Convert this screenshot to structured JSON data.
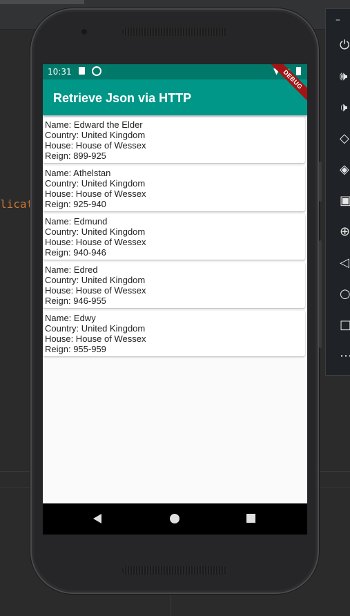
{
  "ide": {
    "code_fragment": "licat"
  },
  "emulator_controls": [
    {
      "icon": "power-icon",
      "glyph": "⏻"
    },
    {
      "icon": "volume-up-icon",
      "glyph": "🕪"
    },
    {
      "icon": "volume-down-icon",
      "glyph": "🕩"
    },
    {
      "icon": "rotate-left-icon",
      "glyph": "◇"
    },
    {
      "icon": "rotate-right-icon",
      "glyph": "◈"
    },
    {
      "icon": "camera-icon",
      "glyph": "▣"
    },
    {
      "icon": "zoom-icon",
      "glyph": "⊕"
    },
    {
      "icon": "back-icon",
      "glyph": "◁"
    },
    {
      "icon": "home-icon",
      "glyph": "○"
    },
    {
      "icon": "overview-icon",
      "glyph": "□"
    },
    {
      "icon": "more-icon",
      "glyph": "⋯"
    }
  ],
  "status_bar": {
    "time": "10:31"
  },
  "app_bar": {
    "title": "Retrieve Json via HTTP"
  },
  "debug_banner": "DEBUG",
  "kings": [
    {
      "name": "Name: Edward the Elder",
      "country": "Country: United Kingdom",
      "house": "House: House of Wessex",
      "reign": "Reign: 899-925"
    },
    {
      "name": "Name: Athelstan",
      "country": "Country: United Kingdom",
      "house": "House: House of Wessex",
      "reign": "Reign: 925-940"
    },
    {
      "name": "Name: Edmund",
      "country": "Country: United Kingdom",
      "house": "House: House of Wessex",
      "reign": "Reign: 940-946"
    },
    {
      "name": "Name: Edred",
      "country": "Country: United Kingdom",
      "house": "House: House of Wessex",
      "reign": "Reign: 946-955"
    },
    {
      "name": "Name: Edwy",
      "country": "Country: United Kingdom",
      "house": "House: House of Wessex",
      "reign": "Reign: 955-959"
    }
  ],
  "colors": {
    "primary": "#009688",
    "primary_dark": "#00796b",
    "debug": "#a31515"
  }
}
